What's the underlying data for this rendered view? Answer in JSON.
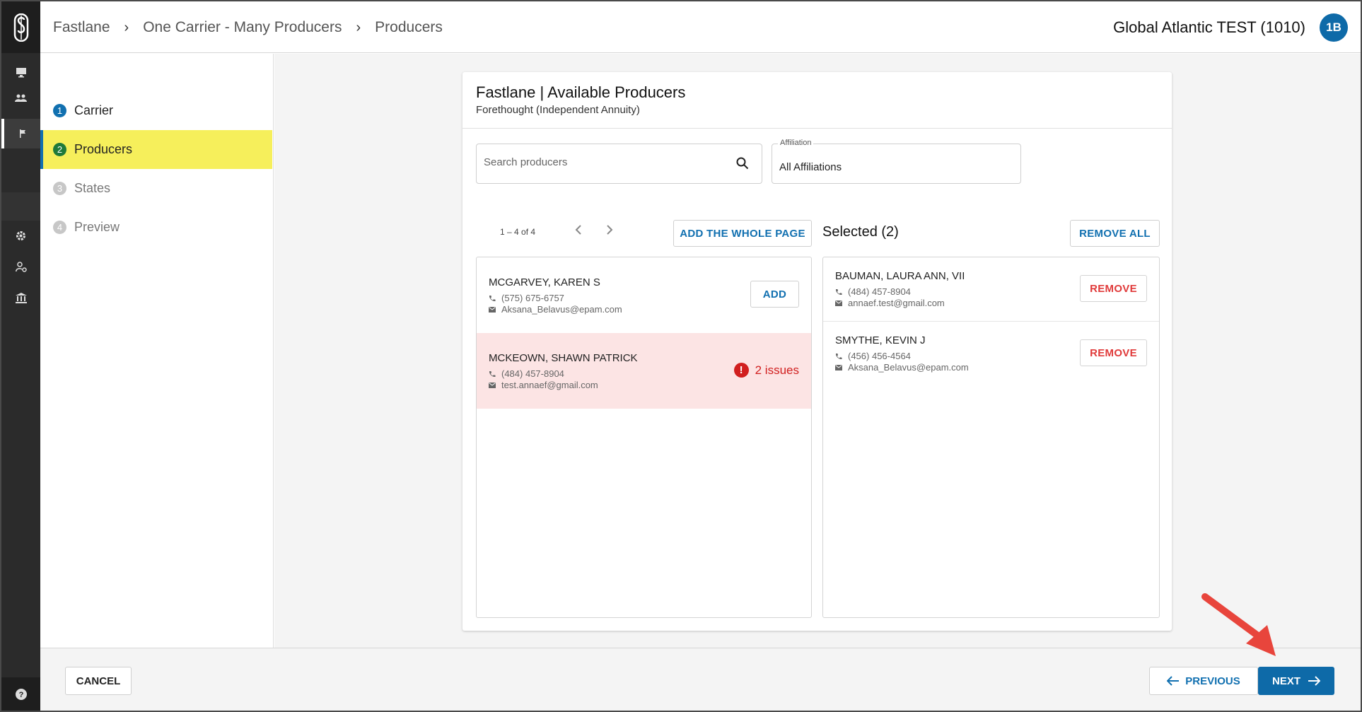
{
  "header": {
    "breadcrumbs": [
      "Fastlane",
      "One Carrier - Many Producers",
      "Producers"
    ],
    "org_name": "Global Atlantic TEST (1010)",
    "avatar_initials": "1B"
  },
  "rail": {
    "items": [
      "monitor-icon",
      "people-icon",
      "store-icon",
      "flag-icon",
      "settings-icon",
      "user-settings-icon",
      "bank-icon"
    ],
    "help_icon": "help-icon"
  },
  "steps": [
    {
      "num": "1",
      "label": "Carrier",
      "state": "done"
    },
    {
      "num": "2",
      "label": "Producers",
      "state": "current"
    },
    {
      "num": "3",
      "label": "States",
      "state": "todo"
    },
    {
      "num": "4",
      "label": "Preview",
      "state": "todo"
    }
  ],
  "card": {
    "title": "Fastlane | Available Producers",
    "subtitle": "Forethought (Independent Annuity)"
  },
  "search": {
    "placeholder": "Search producers"
  },
  "affiliation": {
    "label": "Affiliation",
    "value": "All Affiliations"
  },
  "available": {
    "pager_text": "1 – 4 of 4",
    "add_page_label": "ADD THE WHOLE PAGE",
    "add_label": "ADD",
    "producers": [
      {
        "name": "MCGARVEY, KAREN S",
        "phone": "(575) 675-6757",
        "email": "Aksana_Belavus@epam.com"
      },
      {
        "name": "MCKEOWN, SHAWN PATRICK",
        "phone": "(484) 457-8904",
        "email": "test.annaef@gmail.com",
        "issues": "2 issues"
      }
    ]
  },
  "selected": {
    "title": "Selected (2)",
    "remove_all_label": "REMOVE ALL",
    "remove_label": "REMOVE",
    "producers": [
      {
        "name": "BAUMAN, LAURA ANN, VII",
        "phone": "(484) 457-8904",
        "email": "annaef.test@gmail.com"
      },
      {
        "name": "SMYTHE, KEVIN J",
        "phone": "(456) 456-4564",
        "email": "Aksana_Belavus@epam.com"
      }
    ]
  },
  "footer": {
    "cancel_label": "CANCEL",
    "previous_label": "PREVIOUS",
    "next_label": "NEXT"
  },
  "colors": {
    "primary": "#0e6aa8",
    "current_step_highlight": "#f6ef5b",
    "issue_red": "#d11f1f",
    "annotation_arrow": "#e8453c"
  }
}
